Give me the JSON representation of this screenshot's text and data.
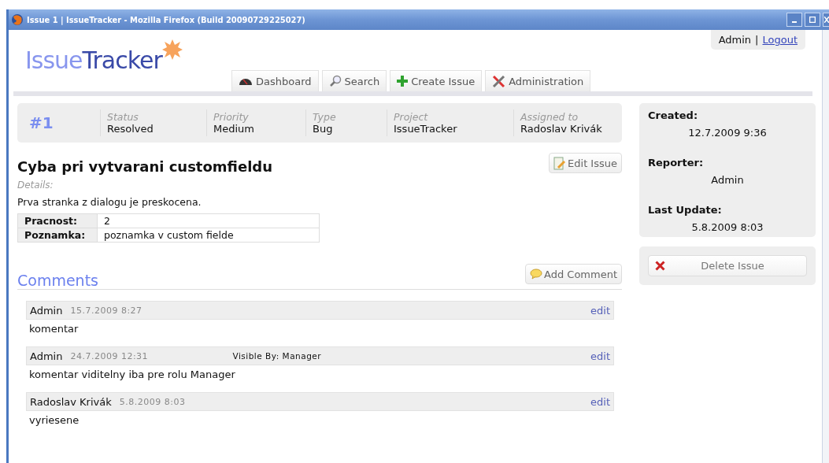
{
  "window": {
    "title": "Issue 1 | IssueTracker - Mozilla Firefox (Build 20090729225027)"
  },
  "logo": {
    "light": "Issue",
    "dark": "Tracker"
  },
  "user": {
    "name": "Admin",
    "separator": "|",
    "logout": "Logout"
  },
  "tabs": [
    {
      "label": "Dashboard",
      "kind": "gauge"
    },
    {
      "label": "Search",
      "kind": "search"
    },
    {
      "label": "Create Issue",
      "kind": "plus"
    },
    {
      "label": "Administration",
      "kind": "tools"
    }
  ],
  "issue": {
    "number": "#1",
    "fields": [
      {
        "label": "Status",
        "value": "Resolved"
      },
      {
        "label": "Priority",
        "value": "Medium"
      },
      {
        "label": "Type",
        "value": "Bug"
      },
      {
        "label": "Project",
        "value": "IssueTracker"
      },
      {
        "label": "Assigned to",
        "value": "Radoslav Krivák"
      }
    ],
    "title": "Cyba pri vytvarani customfieldu",
    "edit_button": "Edit Issue",
    "details_label": "Details:",
    "description": "Prva stranka z dialogu je preskocena.",
    "custom_fields": [
      {
        "label": "Pracnost:",
        "value": "2"
      },
      {
        "label": "Poznamka:",
        "value": "poznamka v custom fielde"
      }
    ]
  },
  "comments": {
    "heading": "Comments",
    "add_button": "Add Comment",
    "items": [
      {
        "author": "Admin",
        "date": "15.7.2009 8:27",
        "edit": "edit",
        "text": "komentar"
      },
      {
        "author": "Admin",
        "date": "24.7.2009 12:31",
        "visibility": "Visible By: Manager",
        "edit": "edit",
        "text": "komentar viditelny iba pre rolu Manager"
      },
      {
        "author": "Radoslav Krivák",
        "date": "5.8.2009 8:03",
        "edit": "edit",
        "text": "vyriesene"
      }
    ]
  },
  "sidebar": {
    "info": [
      {
        "label": "Created:",
        "value": "12.7.2009 9:36"
      },
      {
        "label": "Reporter:",
        "value": "Admin"
      },
      {
        "label": "Last Update:",
        "value": "5.8.2009 8:03"
      }
    ],
    "delete_button": "Delete Issue"
  }
}
